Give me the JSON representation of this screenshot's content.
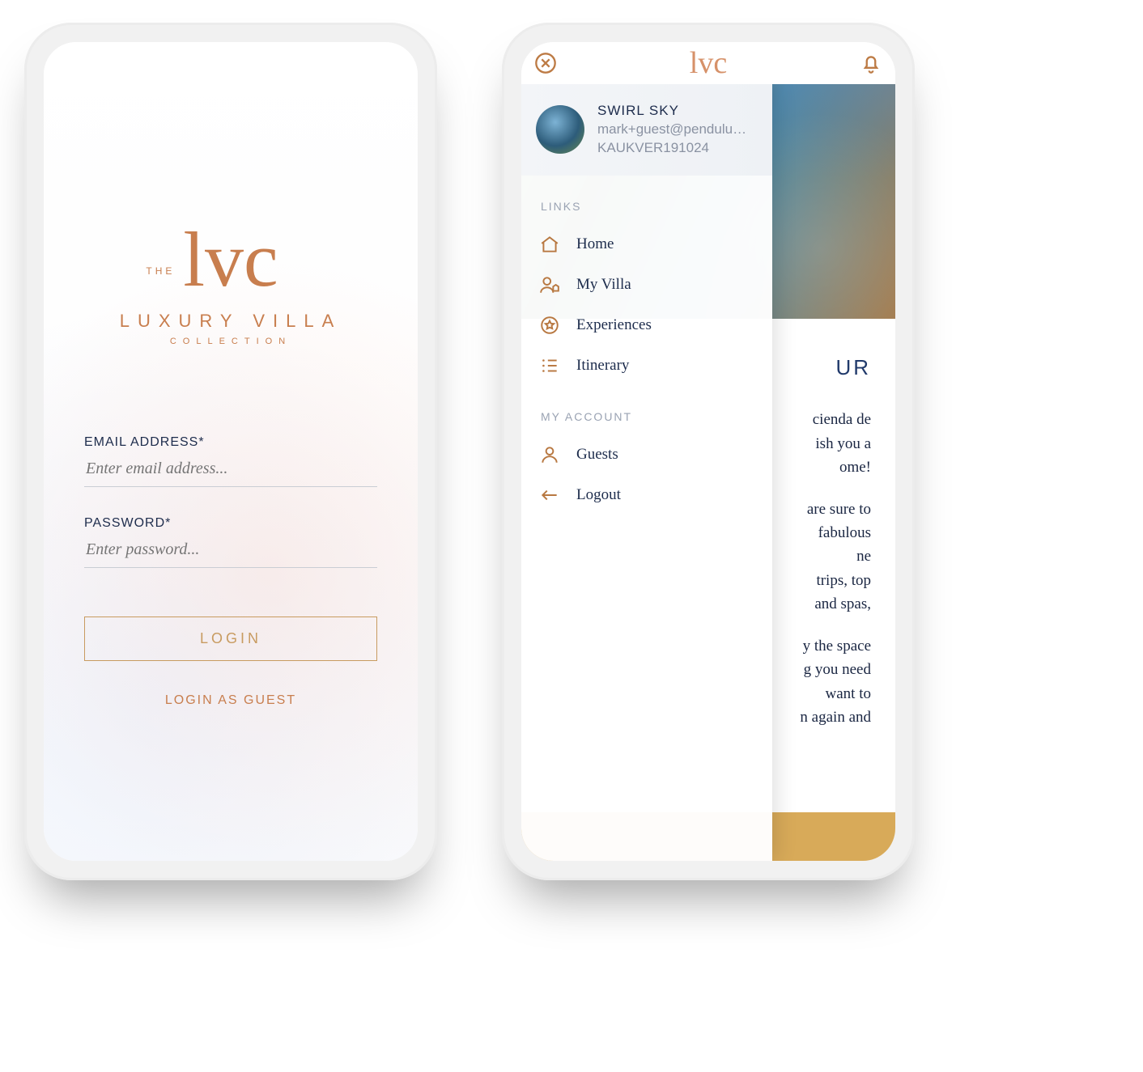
{
  "brand": {
    "the": "THE",
    "script": "lvc",
    "name": "LUXURY VILLA",
    "sub": "COLLECTION"
  },
  "login": {
    "email_label": "EMAIL ADDRESS*",
    "email_placeholder": "Enter email address...",
    "password_label": "PASSWORD*",
    "password_placeholder": "Enter password...",
    "login_button": "LOGIN",
    "guest_link": "LOGIN AS GUEST"
  },
  "topbar": {
    "logo": "lvc"
  },
  "user": {
    "name": "SWIRL SKY",
    "email": "mark+guest@pendulumcr...",
    "ref": "KAUKVER191024"
  },
  "menu": {
    "links_header": "LINKS",
    "account_header": "MY ACCOUNT",
    "items_links": [
      {
        "label": "Home"
      },
      {
        "label": "My Villa"
      },
      {
        "label": "Experiences"
      },
      {
        "label": "Itinerary"
      }
    ],
    "items_account": [
      {
        "label": "Guests"
      },
      {
        "label": "Logout"
      }
    ]
  },
  "background_page": {
    "heading_fragment": "UR",
    "body_fragments": [
      "cienda de",
      "ish you a",
      "ome!",
      "are sure to",
      "fabulous",
      "ne",
      "trips, top",
      "and spas,",
      "y the space",
      "g you need",
      "want to",
      "n again and"
    ]
  },
  "colors": {
    "accent": "#c87e4e",
    "accent_alt": "#c89b60",
    "navy": "#1d2c4c",
    "muted": "#7a8696",
    "button_bar": "#d8aa59"
  }
}
